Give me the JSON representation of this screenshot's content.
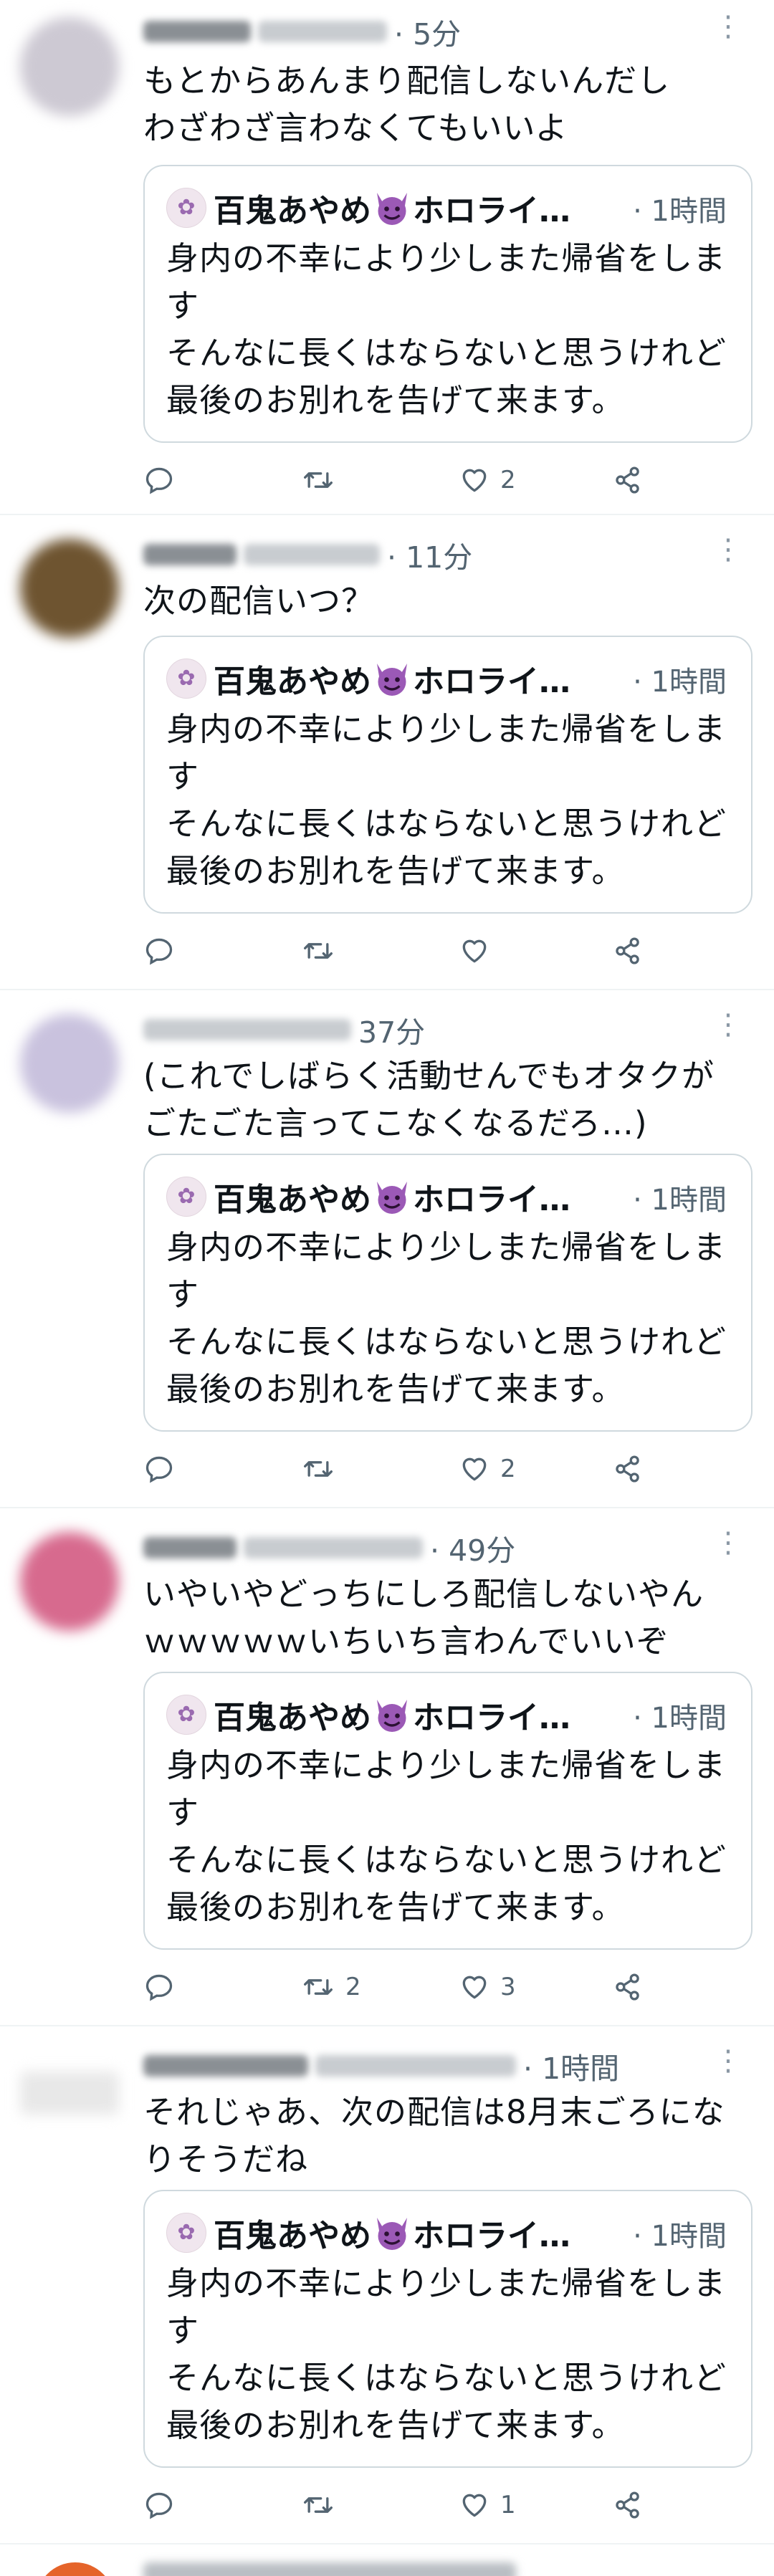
{
  "quoted_tweet": {
    "author_name": "百鬼あやめ",
    "author_suffix": "ホロライ…",
    "devil_emoji": "smiling-face-with-horns-icon",
    "time": "· 1時間",
    "text": "身内の不幸により少しまた帰省をします\nそんなに長くはならないと思うけれど最後のお別れを告げて来ます。"
  },
  "replies": [
    {
      "time": "· 5分",
      "text": "もとからあんまり配信しないんだし\nわざわざ言わなくてもいいよ",
      "reply_count": "",
      "retweet_count": "",
      "like_count": "2",
      "avatar_color": "#cdc9d3"
    },
    {
      "time": "· 11分",
      "text": "次の配信いつ？",
      "reply_count": "",
      "retweet_count": "",
      "like_count": "",
      "avatar_color": "#6e5430"
    },
    {
      "time": "37分",
      "text": "(これでしばらく活動せんでもオタクがごたごた言ってこなくなるだろ…)",
      "reply_count": "",
      "retweet_count": "",
      "like_count": "2",
      "avatar_color": "#c9c2de"
    },
    {
      "time": "· 49分",
      "text": "いやいやどっちにしろ配信しないやん\nｗｗｗｗｗいちいち言わんでいいぞ",
      "reply_count": "",
      "retweet_count": "2",
      "like_count": "3",
      "avatar_color": "#d76a8e"
    },
    {
      "time": "· 1時間",
      "text": "それじゃあ、次の配信は8月末ごろになりそうだね",
      "reply_count": "",
      "retweet_count": "",
      "like_count": "1",
      "avatar_color": "#e8e8e8"
    }
  ],
  "next_tweet_partial": {
    "avatar_color": "#e5642a"
  },
  "colors": {
    "text": "#0f1419",
    "secondary": "#536471",
    "border": "#cfd9de",
    "divider": "#eff3f4"
  }
}
